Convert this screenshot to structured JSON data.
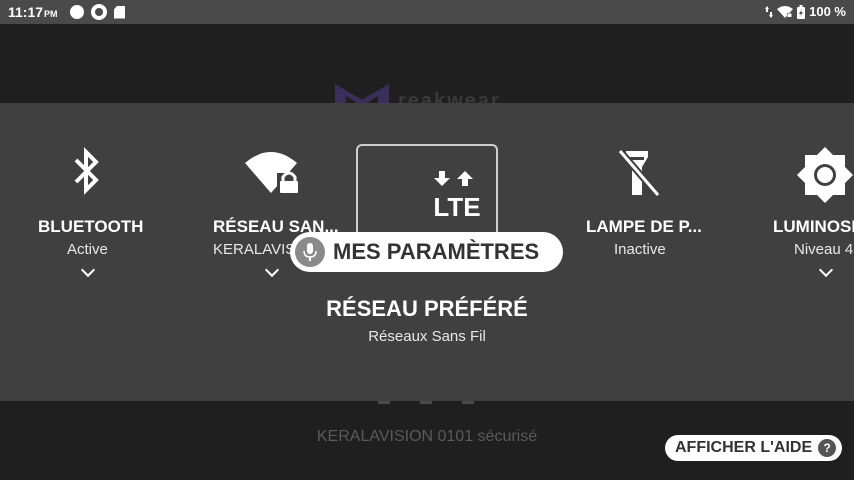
{
  "status_bar": {
    "time": "11:17",
    "ampm": "PM",
    "battery": "100 %",
    "icons": [
      "circle-notification-icon",
      "settings-notification-icon",
      "sd-card-icon",
      "data-arrows-icon",
      "wifi-locked-icon",
      "battery-charging-icon"
    ]
  },
  "background": {
    "logo_text": "reakwear",
    "ssid_text": "KERALAVISION 0101 sécurisé"
  },
  "tiles": [
    {
      "title": "BLUETOOTH",
      "subtitle": "Active",
      "icon": "bluetooth-icon"
    },
    {
      "title": "RÉSEAU SAN...",
      "subtitle": "KERALAVIS",
      "icon": "wifi-locked-icon"
    },
    {
      "title": "",
      "subtitle": "",
      "icon": "lte-data-icon"
    },
    {
      "title": "LAMPE DE P...",
      "subtitle": "Inactive",
      "icon": "flashlight-off-icon"
    },
    {
      "title": "LUMINOSI",
      "subtitle": "Niveau 4",
      "icon": "brightness-icon"
    }
  ],
  "focused": {
    "title": "RÉSEAU PRÉFÉRÉ",
    "subtitle": "Réseaux Sans Fil",
    "icon_label": "LTE"
  },
  "assistant_pill": {
    "label": "MES PARAMÈTRES",
    "icon": "mic-icon"
  },
  "help_button": {
    "label": "AFFICHER L'AIDE",
    "icon_char": "?"
  },
  "colors": {
    "status_bar": "#4a4a4a",
    "panel": "#404040",
    "background": "#1f1f1f"
  }
}
